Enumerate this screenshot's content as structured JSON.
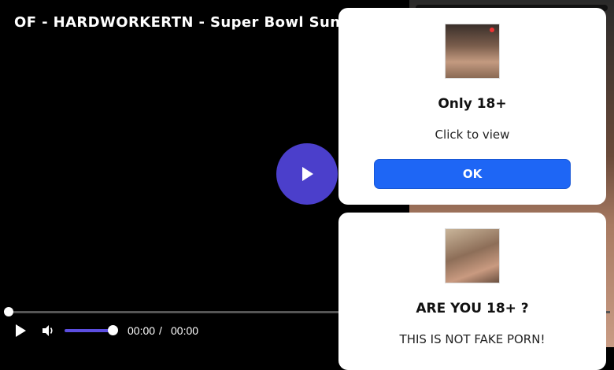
{
  "video": {
    "title": "OF - HARDWORKERTN - Super Bowl Sunday",
    "current_time": "00:00",
    "separator": "/",
    "duration": "00:00",
    "volume_level": 1.0,
    "progress": 0.0,
    "accent_color": "#4b3fcb"
  },
  "icons": {
    "center_play": "play-icon",
    "play": "play-icon",
    "volume": "volume-icon"
  },
  "popups": [
    {
      "heading": "Only 18+",
      "subtext": "Click to view",
      "button_label": "OK",
      "button_color": "#1e66f5"
    },
    {
      "heading": "ARE YOU 18+ ?",
      "subtext": "THIS IS NOT FAKE PORN!"
    }
  ]
}
